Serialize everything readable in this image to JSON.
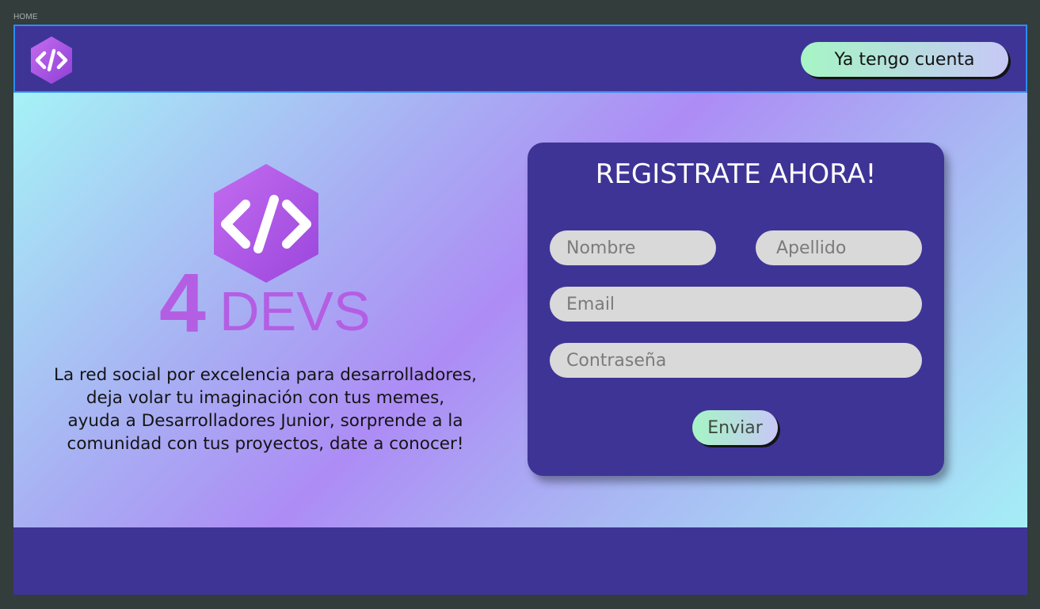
{
  "frame": {
    "label": "HOME"
  },
  "header": {
    "login_button": "Ya tengo cuenta"
  },
  "hero": {
    "logo": {
      "number": "4",
      "wordmark": "DEVS",
      "icon": "code-brackets-hexagon-icon"
    },
    "tagline": "La red social por excelencia para desarrolladores,\ndeja volar tu imaginación con tus memes,\nayuda a Desarrolladores Junior, sorprende a la\ncomunidad con tus proyectos, date a conocer!"
  },
  "register_form": {
    "title": "REGISTRATE AHORA!",
    "first_name_placeholder": "Nombre",
    "last_name_placeholder": "Apellido",
    "email_placeholder": "Email",
    "password_placeholder": "Contraseña",
    "submit_label": "Enviar"
  },
  "colors": {
    "navbar": "#3e3496",
    "card": "#3e3496",
    "footer": "#3e3496",
    "field": "#d9d9d9",
    "button_gradient_start": "#a6f5c5",
    "button_gradient_end": "#c7c8f6",
    "logo_purple": "#b85fe6",
    "frame_background": "#333d3c"
  }
}
